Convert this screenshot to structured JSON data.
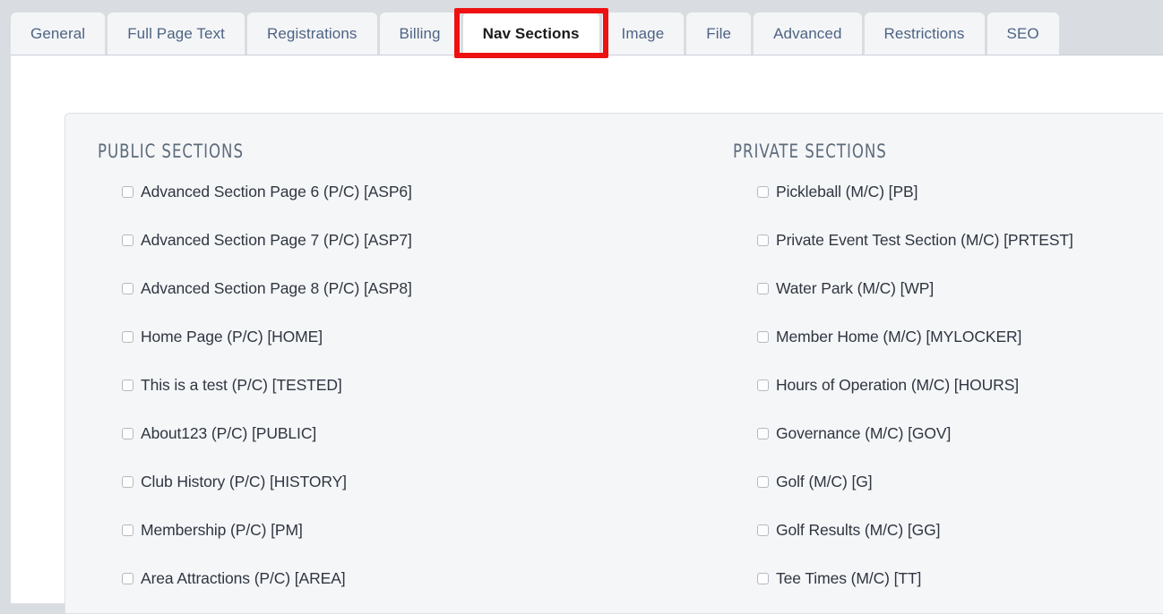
{
  "tabs": [
    {
      "label": "General",
      "active": false
    },
    {
      "label": "Full Page Text",
      "active": false
    },
    {
      "label": "Registrations",
      "active": false
    },
    {
      "label": "Billing",
      "active": false
    },
    {
      "label": "Nav Sections",
      "active": true
    },
    {
      "label": "Image",
      "active": false
    },
    {
      "label": "File",
      "active": false
    },
    {
      "label": "Advanced",
      "active": false
    },
    {
      "label": "Restrictions",
      "active": false
    },
    {
      "label": "SEO",
      "active": false
    }
  ],
  "highlight": {
    "target_tab": "Nav Sections",
    "color": "#ee1111"
  },
  "panel": {
    "public": {
      "heading": "PUBLIC SECTIONS",
      "items": [
        {
          "label": "Advanced Section Page 6 (P/C) [ASP6]",
          "checked": false
        },
        {
          "label": "Advanced Section Page 7 (P/C) [ASP7]",
          "checked": false
        },
        {
          "label": "Advanced Section Page 8 (P/C) [ASP8]",
          "checked": false
        },
        {
          "label": "Home Page (P/C) [HOME]",
          "checked": false
        },
        {
          "label": "This is a test (P/C) [TESTED]",
          "checked": false
        },
        {
          "label": "About123 (P/C) [PUBLIC]",
          "checked": false
        },
        {
          "label": "Club History (P/C) [HISTORY]",
          "checked": false
        },
        {
          "label": "Membership (P/C) [PM]",
          "checked": false
        },
        {
          "label": "Area Attractions (P/C) [AREA]",
          "checked": false
        }
      ]
    },
    "private": {
      "heading": "PRIVATE SECTIONS",
      "items": [
        {
          "label": "Pickleball (M/C) [PB]",
          "checked": false
        },
        {
          "label": "Private Event Test Section (M/C) [PRTEST]",
          "checked": false
        },
        {
          "label": "Water Park (M/C) [WP]",
          "checked": false
        },
        {
          "label": "Member Home (M/C) [MYLOCKER]",
          "checked": false
        },
        {
          "label": "Hours of Operation (M/C) [HOURS]",
          "checked": false
        },
        {
          "label": "Governance (M/C) [GOV]",
          "checked": false
        },
        {
          "label": "Golf (M/C) [G]",
          "checked": false
        },
        {
          "label": "Golf Results (M/C) [GG]",
          "checked": false
        },
        {
          "label": "Tee Times (M/C) [TT]",
          "checked": false
        }
      ]
    }
  },
  "colors": {
    "page_background": "#d9dde1",
    "tab_inactive_bg": "#f4f5f7",
    "tab_active_bg": "#ffffff",
    "tab_text": "#4d6384",
    "panel_bg": "#f5f6f8",
    "panel_border": "#dbe0e6",
    "item_text": "#2f3640",
    "heading_text": "#5d6b7a",
    "highlight_red": "#ee1111"
  }
}
